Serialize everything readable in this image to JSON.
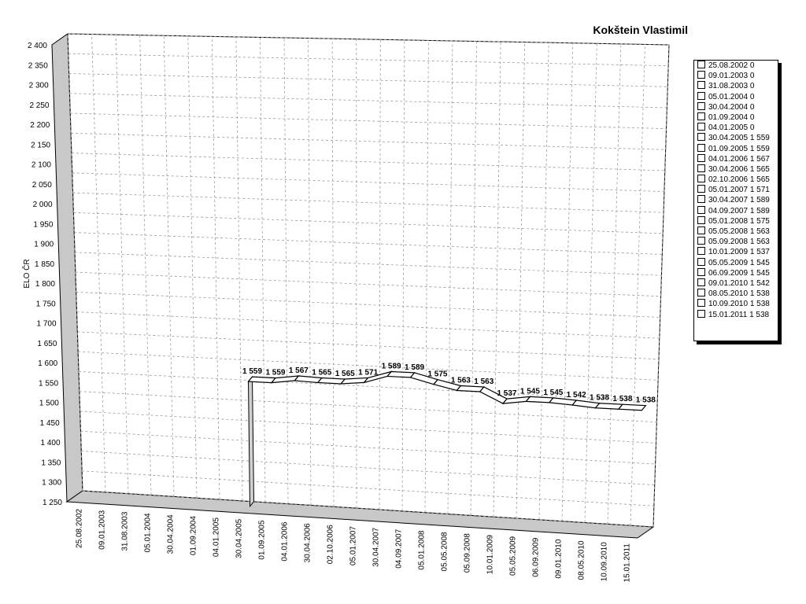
{
  "chart_data": {
    "type": "line",
    "title": "Kokštein Vlastimil",
    "ylabel": "ELO ČR",
    "xlabel": "",
    "ylim": [
      1250,
      2400
    ],
    "yticks": [
      1250,
      1300,
      1350,
      1400,
      1450,
      1500,
      1550,
      1600,
      1650,
      1700,
      1750,
      1800,
      1850,
      1900,
      1950,
      2000,
      2050,
      2100,
      2150,
      2200,
      2250,
      2300,
      2350,
      2400
    ],
    "ytick_labels": [
      "1 250",
      "1 300",
      "1 350",
      "1 400",
      "1 450",
      "1 500",
      "1 550",
      "1 600",
      "1 650",
      "1 700",
      "1 750",
      "1 800",
      "1 850",
      "1 900",
      "1 950",
      "2 000",
      "2 050",
      "2 100",
      "2 150",
      "2 200",
      "2 250",
      "2 300",
      "2 350",
      "2 400"
    ],
    "grid": true,
    "legend_position": "right",
    "categories": [
      "25.08.2002",
      "09.01.2003",
      "31.08.2003",
      "05.01.2004",
      "30.04.2004",
      "01.09.2004",
      "04.01.2005",
      "30.04.2005",
      "01.09.2005",
      "04.01.2006",
      "30.04.2006",
      "02.10.2006",
      "05.01.2007",
      "30.04.2007",
      "04.09.2007",
      "05.01.2008",
      "05.05.2008",
      "05.09.2008",
      "10.01.2009",
      "05.05.2009",
      "06.09.2009",
      "09.01.2010",
      "08.05.2010",
      "10.09.2010",
      "15.01.2011"
    ],
    "values": [
      0,
      0,
      0,
      0,
      0,
      0,
      0,
      1559,
      1559,
      1567,
      1565,
      1565,
      1571,
      1589,
      1589,
      1575,
      1563,
      1563,
      1537,
      1545,
      1545,
      1542,
      1538,
      1538,
      1538
    ],
    "data_labels": [
      "",
      "",
      "",
      "",
      "",
      "",
      "",
      "1 559",
      "1 559",
      "1 567",
      "1 565",
      "1 565",
      "1 571",
      "1 589",
      "1 589",
      "1 575",
      "1 563",
      "1 563",
      "1 537",
      "1 545",
      "1 545",
      "1 542",
      "1 538",
      "1 538",
      "1 538"
    ],
    "legend_entries": [
      "25.08.2002 0",
      "09.01.2003 0",
      "31.08.2003 0",
      "05.01.2004 0",
      "30.04.2004 0",
      "01.09.2004 0",
      "04.01.2005 0",
      "30.04.2005 1 559",
      "01.09.2005 1 559",
      "04.01.2006 1 567",
      "30.04.2006 1 565",
      "02.10.2006 1 565",
      "05.01.2007 1 571",
      "30.04.2007 1 589",
      "04.09.2007 1 589",
      "05.01.2008 1 575",
      "05.05.2008 1 563",
      "05.09.2008 1 563",
      "10.01.2009 1 537",
      "05.05.2009 1 545",
      "06.09.2009 1 545",
      "09.01.2010 1 542",
      "08.05.2010 1 538",
      "10.09.2010 1 538",
      "15.01.2011 1 538"
    ]
  }
}
